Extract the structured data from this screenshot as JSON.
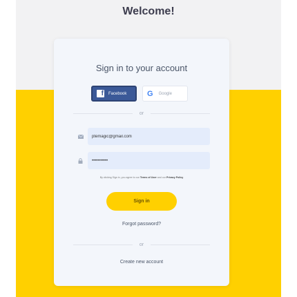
{
  "page": {
    "welcome": "Welcome!"
  },
  "card": {
    "title": "Sign in to your account",
    "facebook_label": "Facebook",
    "google_label": "Google",
    "or_label": "or",
    "email_value": "ptemagic@gmail.com",
    "password_value": "•••••••••••",
    "terms_prefix": "By clicking Sign in, you agree to our",
    "terms_link": "Terms of User",
    "terms_and": "and our",
    "privacy_link": "Privacy Policy",
    "signin_label": "Sign in",
    "forgot_label": "Forgot password?",
    "or_label_2": "or",
    "create_label": "Create new account"
  },
  "colors": {
    "accent": "#ffd000",
    "facebook": "#3b5998",
    "background": "#f2f2f3"
  }
}
